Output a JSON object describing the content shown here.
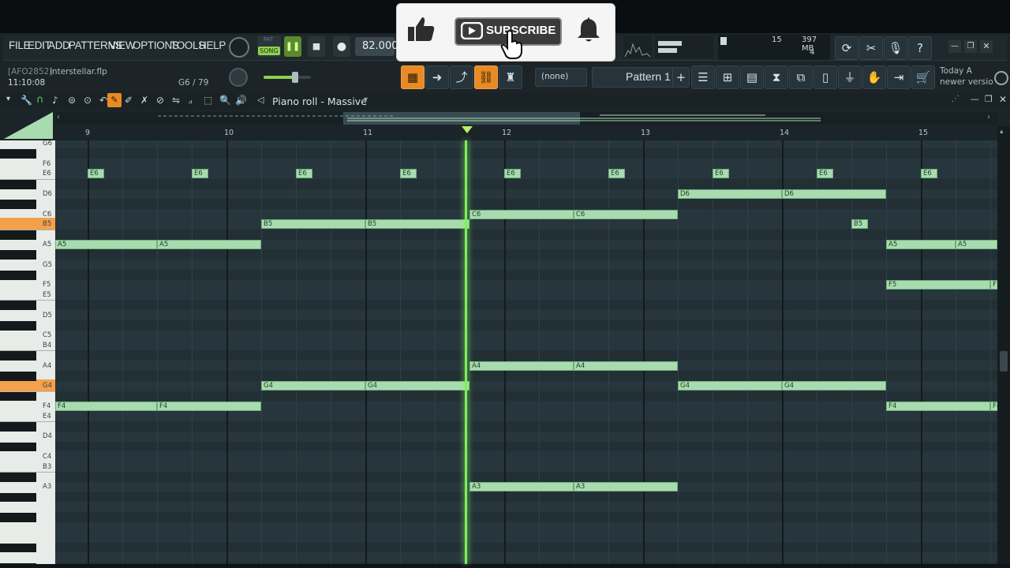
{
  "menu": {
    "items": [
      "FILE",
      "EDIT",
      "ADD",
      "PATTERNS",
      "VIEW",
      "OPTIONS",
      "TOOLS",
      "HELP"
    ]
  },
  "transport": {
    "song_label": "SONG",
    "pat_label": "PAT",
    "tempo": "82.000"
  },
  "project": {
    "id": "[AFO2852]",
    "file": "interstellar.flp",
    "time": "11:10:08",
    "note_info": "G6 / 79"
  },
  "monitor": {
    "cpu": "15",
    "mem": "397 MB",
    "poly": "4"
  },
  "channel": {
    "none_label": "(none)",
    "pattern": "Pattern 1"
  },
  "news": {
    "line1": "Today  A",
    "line2": "newer versio"
  },
  "overlay": {
    "subscribe": "SUBSCRIBE"
  },
  "pianoroll": {
    "title": "Piano roll - Massive",
    "bars": [
      "9",
      "10",
      "11",
      "12",
      "13",
      "14",
      "15"
    ],
    "key_labels": [
      "G6",
      "F6",
      "E6",
      "D6",
      "C6",
      "B5",
      "A5",
      "G5",
      "F5",
      "E5",
      "D5",
      "C5",
      "B4",
      "A4",
      "G4",
      "F4",
      "E4",
      "D4",
      "C4",
      "B3",
      "A3"
    ],
    "notes": [
      {
        "pitch": "E6",
        "label": "E6",
        "start": 9.0,
        "end": 9.12
      },
      {
        "pitch": "E6",
        "label": "E6",
        "start": 9.75,
        "end": 9.87
      },
      {
        "pitch": "E6",
        "label": "E6",
        "start": 10.5,
        "end": 10.62
      },
      {
        "pitch": "E6",
        "label": "E6",
        "start": 11.25,
        "end": 11.37
      },
      {
        "pitch": "E6",
        "label": "E6",
        "start": 12.0,
        "end": 12.12
      },
      {
        "pitch": "E6",
        "label": "E6",
        "start": 12.75,
        "end": 12.87
      },
      {
        "pitch": "E6",
        "label": "E6",
        "start": 13.5,
        "end": 13.62
      },
      {
        "pitch": "E6",
        "label": "E6",
        "start": 14.25,
        "end": 14.37
      },
      {
        "pitch": "E6",
        "label": "E6",
        "start": 15.0,
        "end": 15.12
      },
      {
        "pitch": "D6",
        "label": "D6",
        "start": 13.25,
        "end": 14.0
      },
      {
        "pitch": "D6",
        "label": "D6",
        "start": 14.0,
        "end": 14.75
      },
      {
        "pitch": "C6",
        "label": "C6",
        "start": 11.75,
        "end": 12.5
      },
      {
        "pitch": "C6",
        "label": "C6",
        "start": 12.5,
        "end": 13.25
      },
      {
        "pitch": "B5",
        "label": "B5",
        "start": 10.25,
        "end": 11.0
      },
      {
        "pitch": "B5",
        "label": "B5",
        "start": 11.0,
        "end": 11.75
      },
      {
        "pitch": "B5",
        "label": "B5",
        "start": 14.5,
        "end": 14.62
      },
      {
        "pitch": "A5",
        "label": "A5",
        "start": 8.75,
        "end": 9.5
      },
      {
        "pitch": "A5",
        "label": "A5",
        "start": 9.5,
        "end": 10.25
      },
      {
        "pitch": "A5",
        "label": "A5",
        "start": 14.75,
        "end": 15.25
      },
      {
        "pitch": "A5",
        "label": "A5",
        "start": 15.25,
        "end": 15.6
      },
      {
        "pitch": "F5",
        "label": "F5",
        "start": 14.75,
        "end": 15.5
      },
      {
        "pitch": "F5",
        "label": "F5",
        "start": 15.5,
        "end": 15.6
      },
      {
        "pitch": "A4",
        "label": "A4",
        "start": 11.75,
        "end": 12.5
      },
      {
        "pitch": "A4",
        "label": "A4",
        "start": 12.5,
        "end": 13.25
      },
      {
        "pitch": "G4",
        "label": "G4",
        "start": 10.25,
        "end": 11.0
      },
      {
        "pitch": "G4",
        "label": "G4",
        "start": 11.0,
        "end": 11.75
      },
      {
        "pitch": "G4",
        "label": "G4",
        "start": 13.25,
        "end": 14.0
      },
      {
        "pitch": "G4",
        "label": "G4",
        "start": 14.0,
        "end": 14.75
      },
      {
        "pitch": "F4",
        "label": "F4",
        "start": 8.75,
        "end": 9.5
      },
      {
        "pitch": "F4",
        "label": "F4",
        "start": 9.5,
        "end": 10.25
      },
      {
        "pitch": "F4",
        "label": "F4",
        "start": 14.75,
        "end": 15.5
      },
      {
        "pitch": "F4",
        "label": "F4",
        "start": 15.5,
        "end": 15.6
      },
      {
        "pitch": "A3",
        "label": "A3",
        "start": 11.75,
        "end": 12.5
      },
      {
        "pitch": "A3",
        "label": "A3",
        "start": 12.5,
        "end": 13.25
      }
    ],
    "playhead_bar": 11.72,
    "highlighted_keys": [
      "B5",
      "G4"
    ]
  },
  "colors": {
    "note_fill": "#a8dcb0",
    "playhead": "#7cf05a",
    "accent": "#e88a26"
  }
}
